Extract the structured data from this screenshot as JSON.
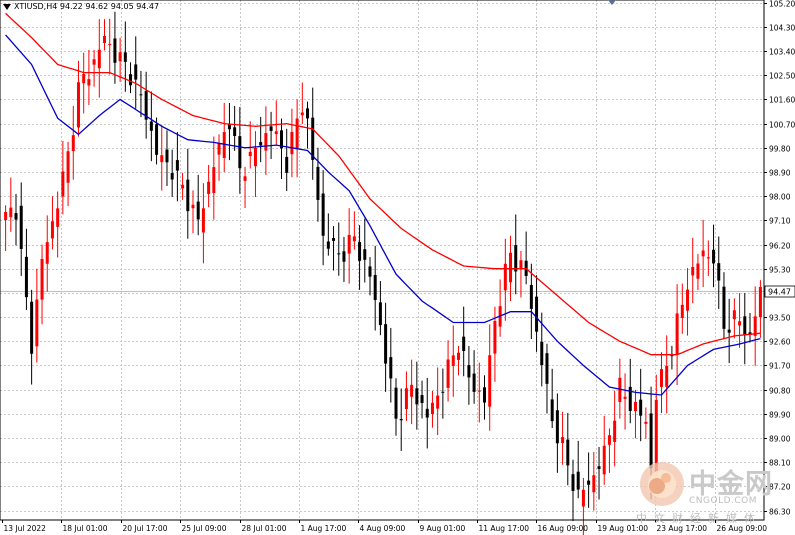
{
  "window": {
    "symbol_label": "XTIUSD,H4  94.22 94.62 94.05 94.47"
  },
  "watermark": {
    "brand": "中金网",
    "url": "CNGOLD.COM",
    "tagline": "中文财经新媒体"
  },
  "chart_data": {
    "type": "candlestick",
    "symbol": "XTIUSD",
    "timeframe": "H4",
    "ohlc_header": {
      "open": 94.22,
      "high": 94.62,
      "low": 94.05,
      "close": 94.47
    },
    "current_price": 94.47,
    "current_price_label": "94.47",
    "y_ticks": [
      "105.20",
      "104.30",
      "103.40",
      "102.50",
      "101.60",
      "100.70",
      "99.80",
      "98.90",
      "98.00",
      "97.10",
      "96.20",
      "95.30",
      "94.40",
      "93.50",
      "92.60",
      "91.70",
      "90.80",
      "89.90",
      "89.00",
      "88.10",
      "87.20",
      "86.30"
    ],
    "ylim": [
      85.95,
      105.3
    ],
    "x_tick_labels": [
      "13 Jul 2022",
      "18 Jul 01:00",
      "20 Jul 17:00",
      "25 Jul 09:00",
      "28 Jul 01:00",
      "1 Aug 17:00",
      "4 Aug 09:00",
      "9 Aug 01:00",
      "11 Aug 17:00",
      "16 Aug 09:00",
      "19 Aug 01:00",
      "23 Aug 17:00",
      "26 Aug 09:00"
    ],
    "colors": {
      "bull": "#ff0000",
      "bear": "#000000",
      "ma_fast": "#0000cc",
      "ma_slow": "#ff0000",
      "grid": "#c8c8c8",
      "price_line": "#c0c0c0"
    },
    "grid": true,
    "close_path": [
      {
        "bar": 0,
        "close": 97.2
      },
      {
        "bar": 2,
        "close": 97.6
      },
      {
        "bar": 4,
        "close": 94.0
      },
      {
        "bar": 5,
        "close": 92.5
      },
      {
        "bar": 7,
        "close": 95.6
      },
      {
        "bar": 9,
        "close": 97.0
      },
      {
        "bar": 12,
        "close": 99.5
      },
      {
        "bar": 14,
        "close": 102.0
      },
      {
        "bar": 17,
        "close": 103.0
      },
      {
        "bar": 19,
        "close": 103.9
      },
      {
        "bar": 21,
        "close": 103.3
      },
      {
        "bar": 24,
        "close": 102.6
      },
      {
        "bar": 27,
        "close": 101.1
      },
      {
        "bar": 29,
        "close": 99.6
      },
      {
        "bar": 32,
        "close": 99.0
      },
      {
        "bar": 35,
        "close": 97.9
      },
      {
        "bar": 37,
        "close": 97.0
      },
      {
        "bar": 40,
        "close": 99.2
      },
      {
        "bar": 43,
        "close": 100.9
      },
      {
        "bar": 45,
        "close": 98.9
      },
      {
        "bar": 48,
        "close": 99.7
      },
      {
        "bar": 51,
        "close": 100.6
      },
      {
        "bar": 54,
        "close": 99.3
      },
      {
        "bar": 57,
        "close": 101.5
      },
      {
        "bar": 58,
        "close": 100.7
      },
      {
        "bar": 61,
        "close": 96.5
      },
      {
        "bar": 64,
        "close": 95.8
      },
      {
        "bar": 67,
        "close": 96.4
      },
      {
        "bar": 70,
        "close": 95.0
      },
      {
        "bar": 72,
        "close": 93.2
      },
      {
        "bar": 75,
        "close": 89.7
      },
      {
        "bar": 78,
        "close": 90.9
      },
      {
        "bar": 81,
        "close": 89.8
      },
      {
        "bar": 84,
        "close": 91.0
      },
      {
        "bar": 87,
        "close": 92.6
      },
      {
        "bar": 89,
        "close": 91.2
      },
      {
        "bar": 92,
        "close": 90.4
      },
      {
        "bar": 94,
        "close": 93.4
      },
      {
        "bar": 97,
        "close": 95.9
      },
      {
        "bar": 100,
        "close": 95.0
      },
      {
        "bar": 102,
        "close": 92.9
      },
      {
        "bar": 105,
        "close": 89.7
      },
      {
        "bar": 107,
        "close": 88.6
      },
      {
        "bar": 110,
        "close": 86.8
      },
      {
        "bar": 113,
        "close": 87.6
      },
      {
        "bar": 115,
        "close": 88.4
      },
      {
        "bar": 118,
        "close": 90.8
      },
      {
        "bar": 121,
        "close": 90.1
      },
      {
        "bar": 123,
        "close": 89.6
      },
      {
        "bar": 124,
        "close": 87.9
      },
      {
        "bar": 125,
        "close": 90.6
      },
      {
        "bar": 128,
        "close": 92.4
      },
      {
        "bar": 131,
        "close": 94.8
      },
      {
        "bar": 134,
        "close": 95.9
      },
      {
        "bar": 136,
        "close": 95.7
      },
      {
        "bar": 138,
        "close": 93.2
      },
      {
        "bar": 141,
        "close": 93.4
      },
      {
        "bar": 143,
        "close": 92.7
      },
      {
        "bar": 145,
        "close": 94.47
      }
    ],
    "ma_fast_path": [
      {
        "bar": 0,
        "value": 104.0
      },
      {
        "bar": 5,
        "value": 102.9
      },
      {
        "bar": 10,
        "value": 100.9
      },
      {
        "bar": 14,
        "value": 100.3
      },
      {
        "bar": 18,
        "value": 101.0
      },
      {
        "bar": 22,
        "value": 101.6
      },
      {
        "bar": 26,
        "value": 101.1
      },
      {
        "bar": 30,
        "value": 100.6
      },
      {
        "bar": 35,
        "value": 100.1
      },
      {
        "bar": 40,
        "value": 100.0
      },
      {
        "bar": 46,
        "value": 99.8
      },
      {
        "bar": 52,
        "value": 99.9
      },
      {
        "bar": 58,
        "value": 99.7
      },
      {
        "bar": 62,
        "value": 98.9
      },
      {
        "bar": 66,
        "value": 98.2
      },
      {
        "bar": 70,
        "value": 96.9
      },
      {
        "bar": 75,
        "value": 95.1
      },
      {
        "bar": 80,
        "value": 94.1
      },
      {
        "bar": 86,
        "value": 93.3
      },
      {
        "bar": 92,
        "value": 93.3
      },
      {
        "bar": 97,
        "value": 93.7
      },
      {
        "bar": 101,
        "value": 93.7
      },
      {
        "bar": 106,
        "value": 92.6
      },
      {
        "bar": 111,
        "value": 91.7
      },
      {
        "bar": 116,
        "value": 90.9
      },
      {
        "bar": 121,
        "value": 90.7
      },
      {
        "bar": 126,
        "value": 90.6
      },
      {
        "bar": 131,
        "value": 91.7
      },
      {
        "bar": 136,
        "value": 92.3
      },
      {
        "bar": 141,
        "value": 92.5
      },
      {
        "bar": 145,
        "value": 92.7
      }
    ],
    "ma_slow_path": [
      {
        "bar": 0,
        "value": 104.8
      },
      {
        "bar": 5,
        "value": 103.9
      },
      {
        "bar": 10,
        "value": 102.9
      },
      {
        "bar": 15,
        "value": 102.6
      },
      {
        "bar": 20,
        "value": 102.6
      },
      {
        "bar": 25,
        "value": 102.2
      },
      {
        "bar": 30,
        "value": 101.6
      },
      {
        "bar": 36,
        "value": 101.0
      },
      {
        "bar": 42,
        "value": 100.7
      },
      {
        "bar": 48,
        "value": 100.6
      },
      {
        "bar": 54,
        "value": 100.7
      },
      {
        "bar": 59,
        "value": 100.5
      },
      {
        "bar": 64,
        "value": 99.5
      },
      {
        "bar": 70,
        "value": 97.9
      },
      {
        "bar": 76,
        "value": 96.8
      },
      {
        "bar": 82,
        "value": 96.0
      },
      {
        "bar": 88,
        "value": 95.4
      },
      {
        "bar": 94,
        "value": 95.3
      },
      {
        "bar": 100,
        "value": 95.3
      },
      {
        "bar": 106,
        "value": 94.3
      },
      {
        "bar": 112,
        "value": 93.3
      },
      {
        "bar": 118,
        "value": 92.6
      },
      {
        "bar": 124,
        "value": 92.1
      },
      {
        "bar": 129,
        "value": 92.1
      },
      {
        "bar": 134,
        "value": 92.5
      },
      {
        "bar": 140,
        "value": 92.8
      },
      {
        "bar": 145,
        "value": 92.9
      }
    ]
  }
}
